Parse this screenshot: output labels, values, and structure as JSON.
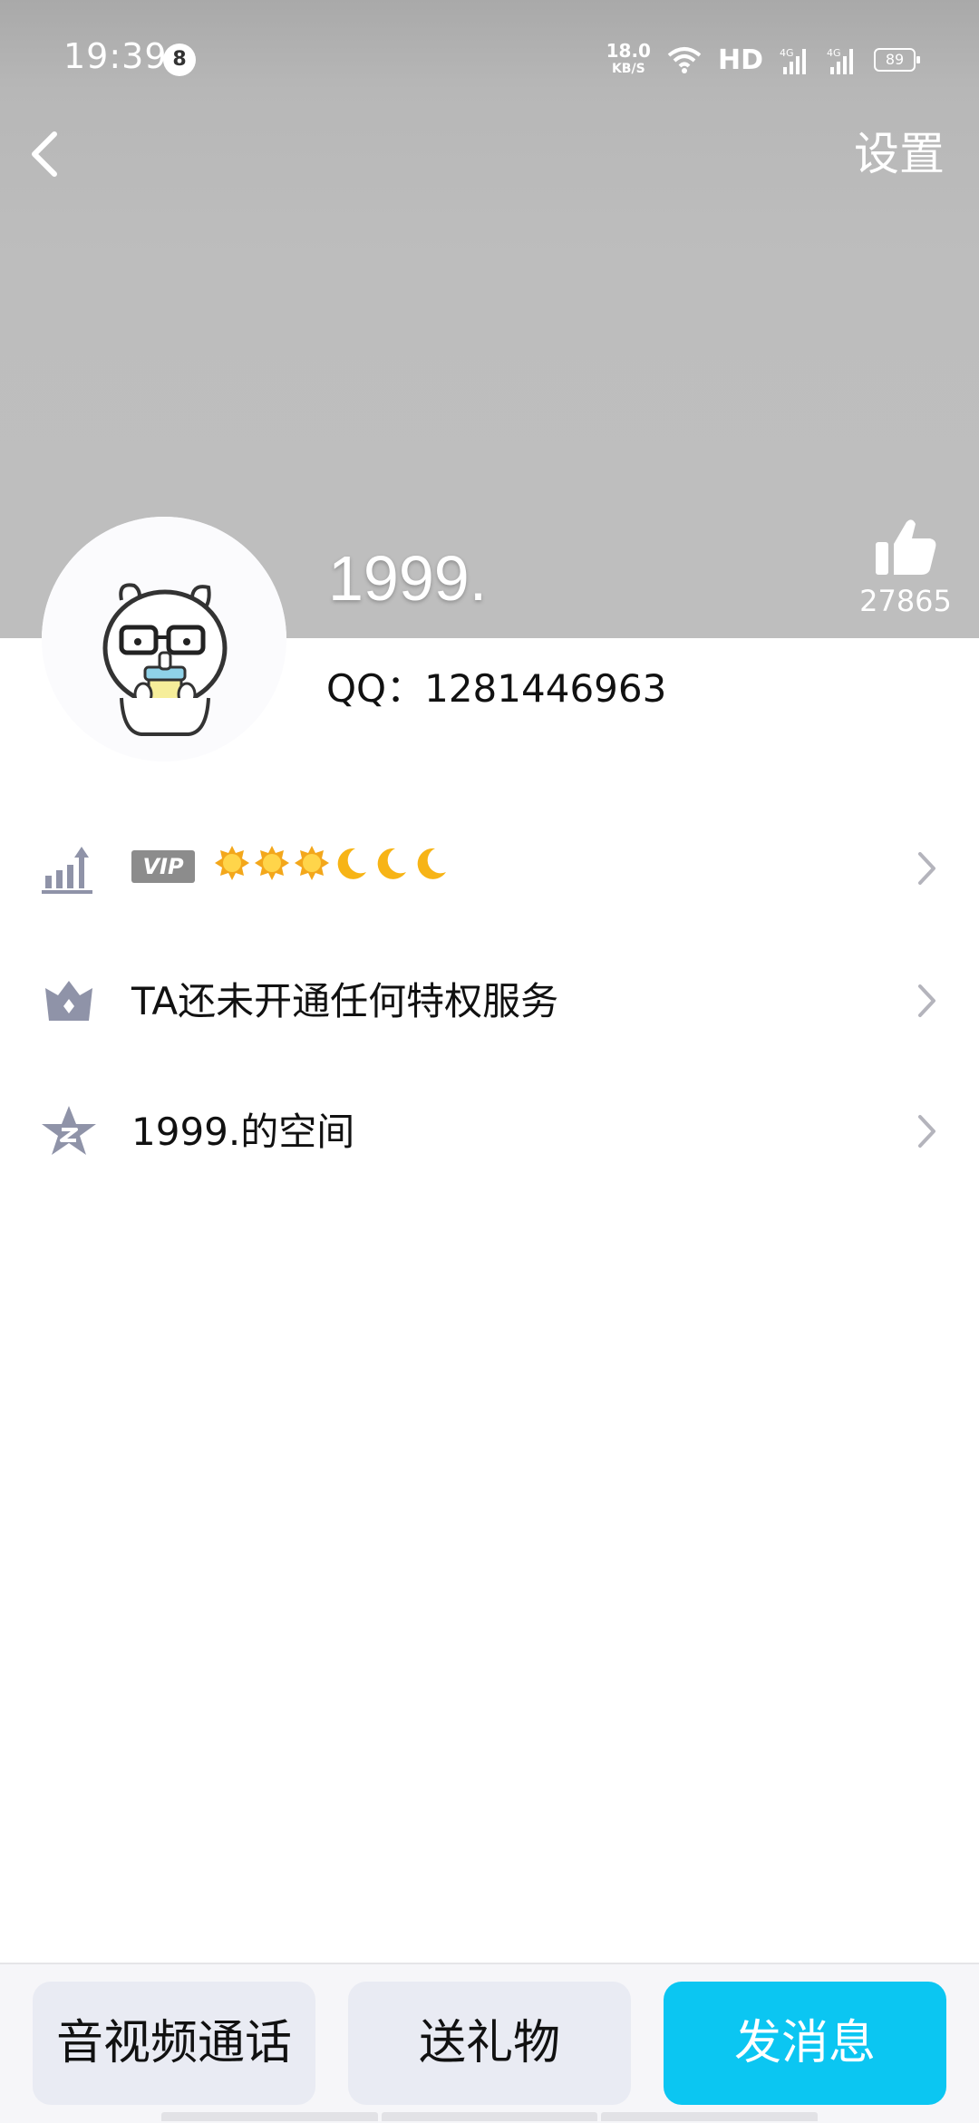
{
  "status_bar": {
    "time": "19:39",
    "notification_count": "8",
    "net_speed_value": "18.0",
    "net_speed_unit": "KB/S",
    "hd_label": "HD",
    "battery_level": "89"
  },
  "nav": {
    "settings_label": "设置"
  },
  "profile": {
    "nickname": "1999.",
    "like_count": "27865",
    "qq_line": "QQ：1281446963"
  },
  "rows": {
    "vip": {
      "badge": "VIP",
      "level_icons": [
        "sun",
        "sun",
        "sun",
        "moon",
        "moon",
        "moon"
      ]
    },
    "privilege": {
      "text": "TA还未开通任何特权服务"
    },
    "space": {
      "text": "1999.的空间"
    }
  },
  "actions": {
    "call_label": "音视频通话",
    "gift_label": "送礼物",
    "message_label": "发消息"
  },
  "colors": {
    "header_bg": "#bdbdbd",
    "primary": "#0bc6f2",
    "secondary_btn": "#e9ebf3",
    "icon_gray": "#8f93a8"
  }
}
